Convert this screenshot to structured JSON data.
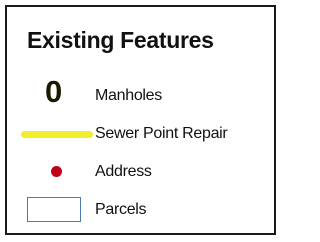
{
  "legend": {
    "title": "Existing Features",
    "items": [
      {
        "label": "Manholes",
        "symbol": "0",
        "symbol_type": "manhole-glyph",
        "color": "#1a1a00"
      },
      {
        "label": "Sewer Point Repair",
        "symbol_type": "line",
        "color": "#f2ee2b"
      },
      {
        "label": "Address",
        "symbol_type": "point",
        "color": "#c0001a"
      },
      {
        "label": "Parcels",
        "symbol_type": "polygon-outline",
        "color": "#4a7bb5"
      }
    ]
  }
}
